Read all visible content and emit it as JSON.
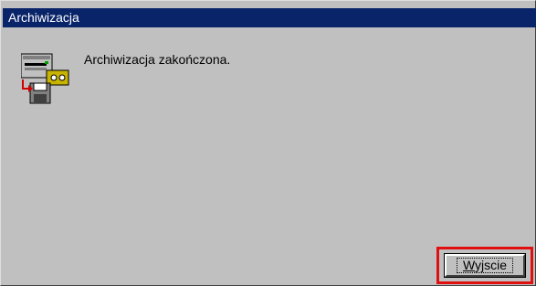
{
  "window": {
    "title": "Archiwizacja"
  },
  "dialog": {
    "message": "Archiwizacja zakończona.",
    "icon": "archive-backup-icon"
  },
  "buttons": {
    "exit_accel": "W",
    "exit_rest": "yjscie"
  },
  "colors": {
    "titlebar": "#0a246a",
    "face": "#c0c0c0",
    "highlight_box": "#e01010"
  }
}
